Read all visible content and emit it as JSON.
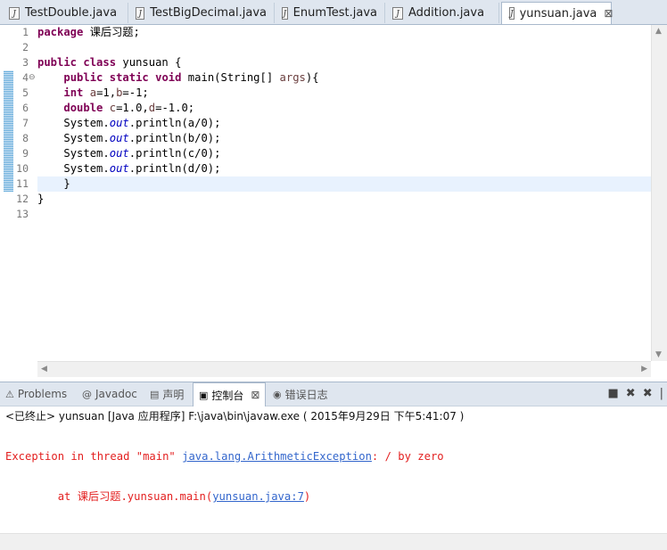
{
  "editor_tabs": [
    {
      "label": "TestDouble.java"
    },
    {
      "label": "TestBigDecimal.java"
    },
    {
      "label": "EnumTest.java"
    },
    {
      "label": "Addition.java"
    },
    {
      "label": "yunsuan.java",
      "active": true
    }
  ],
  "tab_close": "⊠",
  "line_numbers": [
    "1",
    "2",
    "3",
    "4",
    "5",
    "6",
    "7",
    "8",
    "9",
    "10",
    "11",
    "12",
    "13"
  ],
  "code": {
    "l1_kw": "package",
    "l1_rest": " 课后习题;",
    "l3_kw1": "public",
    "l3_kw2": "class",
    "l3_rest": " yunsuan {",
    "l4_kw1": "public",
    "l4_kw2": "static",
    "l4_kw3": "void",
    "l4_a": " main(String[] ",
    "l4_var": "args",
    "l4_b": "){",
    "l5_kw": "int",
    "l5_v1": "a",
    "l5_m": "=1,",
    "l5_v2": "b",
    "l5_e": "=-1;",
    "l6_kw": "double",
    "l6_v1": "c",
    "l6_m": "=1.0,",
    "l6_v2": "d",
    "l6_e": "=-1.0;",
    "l7_a": "System.",
    "l7_f": "out",
    "l7_b": ".println(a/0);",
    "l8_a": "System.",
    "l8_f": "out",
    "l8_b": ".println(b/0);",
    "l9_a": "System.",
    "l9_f": "out",
    "l9_b": ".println(c/0);",
    "l10_a": "System.",
    "l10_f": "out",
    "l10_b": ".println(d/0);",
    "l11": "}",
    "l12": "}"
  },
  "panel_tabs": [
    {
      "icon": "⚠",
      "label": "Problems"
    },
    {
      "icon": "@",
      "label": "Javadoc"
    },
    {
      "icon": "▤",
      "label": "声明"
    },
    {
      "icon": "▣",
      "label": "控制台",
      "active": true
    },
    {
      "icon": "◉",
      "label": "错误日志"
    }
  ],
  "console": {
    "header": "<已终止> yunsuan [Java 应用程序] F:\\java\\bin\\javaw.exe ( 2015年9月29日 下午5:41:07 )",
    "line1_a": "Exception in thread \"main\" ",
    "line1_link": "java.lang.ArithmeticException",
    "line1_b": ": / by zero",
    "line2_a": "        at 课后习题.yunsuan.main(",
    "line2_link": "yunsuan.java:7",
    "line2_b": ")"
  },
  "colors": {
    "keyword": "#7f0055",
    "error": "#e31f1f",
    "link": "#3366cc",
    "field": "#0000c0"
  }
}
